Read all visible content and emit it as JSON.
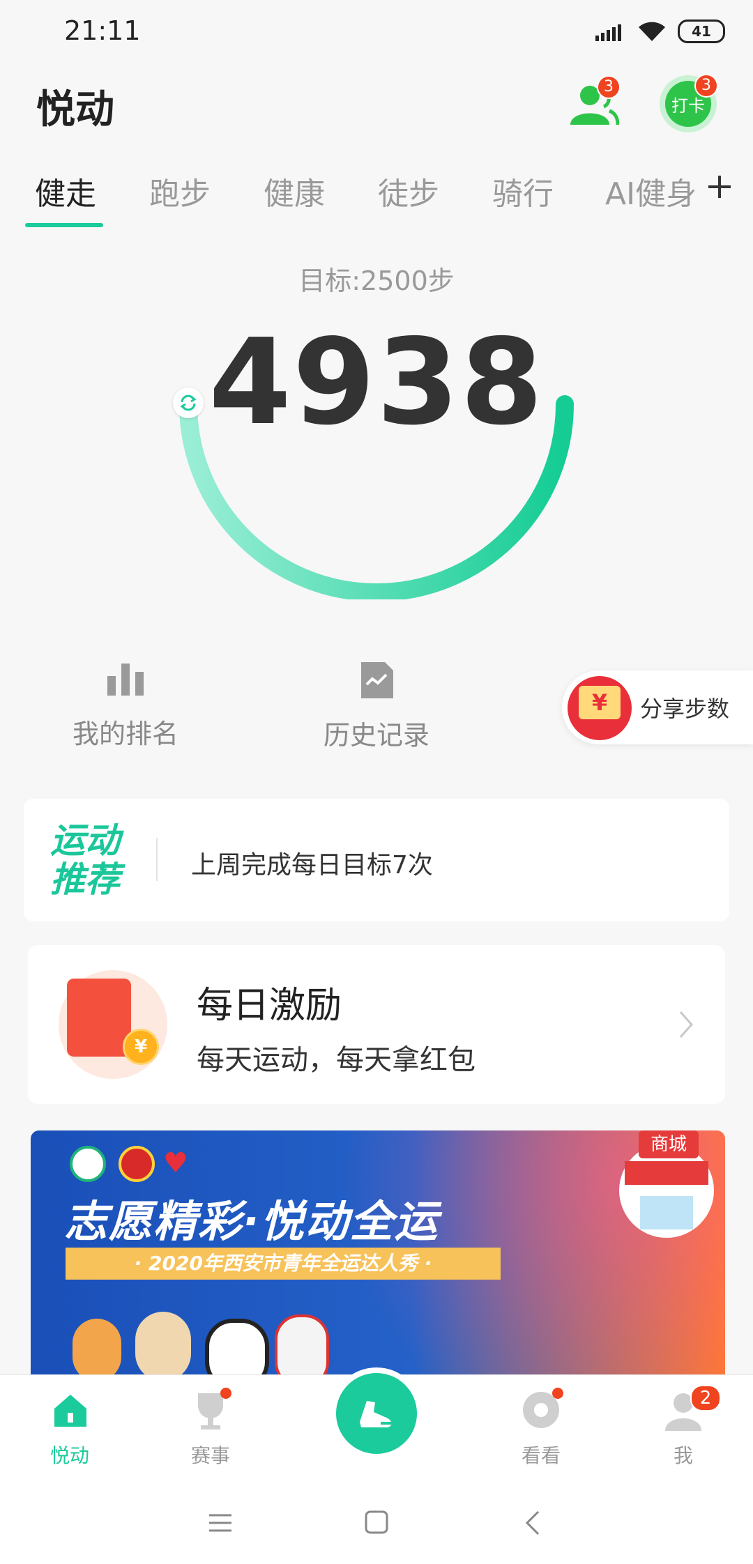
{
  "status_bar": {
    "time": "21:11",
    "battery": "41"
  },
  "header": {
    "title": "悦动",
    "friends_badge": "3",
    "checkin_label": "打卡",
    "checkin_badge": "3"
  },
  "tabs": [
    {
      "label": "健走",
      "active": true
    },
    {
      "label": "跑步"
    },
    {
      "label": "健康"
    },
    {
      "label": "徒步"
    },
    {
      "label": "骑行"
    },
    {
      "label": "AI健身"
    }
  ],
  "step_counter": {
    "goal": "目标:2500步",
    "steps": "4938",
    "goal_progress": 1.0
  },
  "quick_actions": {
    "ranking": "我的排名",
    "history": "历史记录",
    "share": "分享步数",
    "share_icon_symbol": "¥"
  },
  "recommendation": {
    "title_line1": "运动",
    "title_line2": "推荐",
    "text": "上周完成每日目标7次"
  },
  "daily_reward": {
    "title": "每日激励",
    "subtitle": "每天运动，每天拿红包",
    "coin_symbol": "¥"
  },
  "banner": {
    "headline": "志愿精彩·悦动全运",
    "subtitle": "· 2020年西安市青年全运达人秀 ·",
    "shop_label": "商城"
  },
  "bottom_nav": {
    "items": [
      {
        "label": "悦动",
        "active": true
      },
      {
        "label": "赛事"
      },
      {
        "label": "看看"
      },
      {
        "label": "我",
        "badge": "2"
      }
    ]
  },
  "colors": {
    "accent": "#1bcb9b",
    "badge": "#f0431f",
    "green_icon": "#2ec44a"
  }
}
